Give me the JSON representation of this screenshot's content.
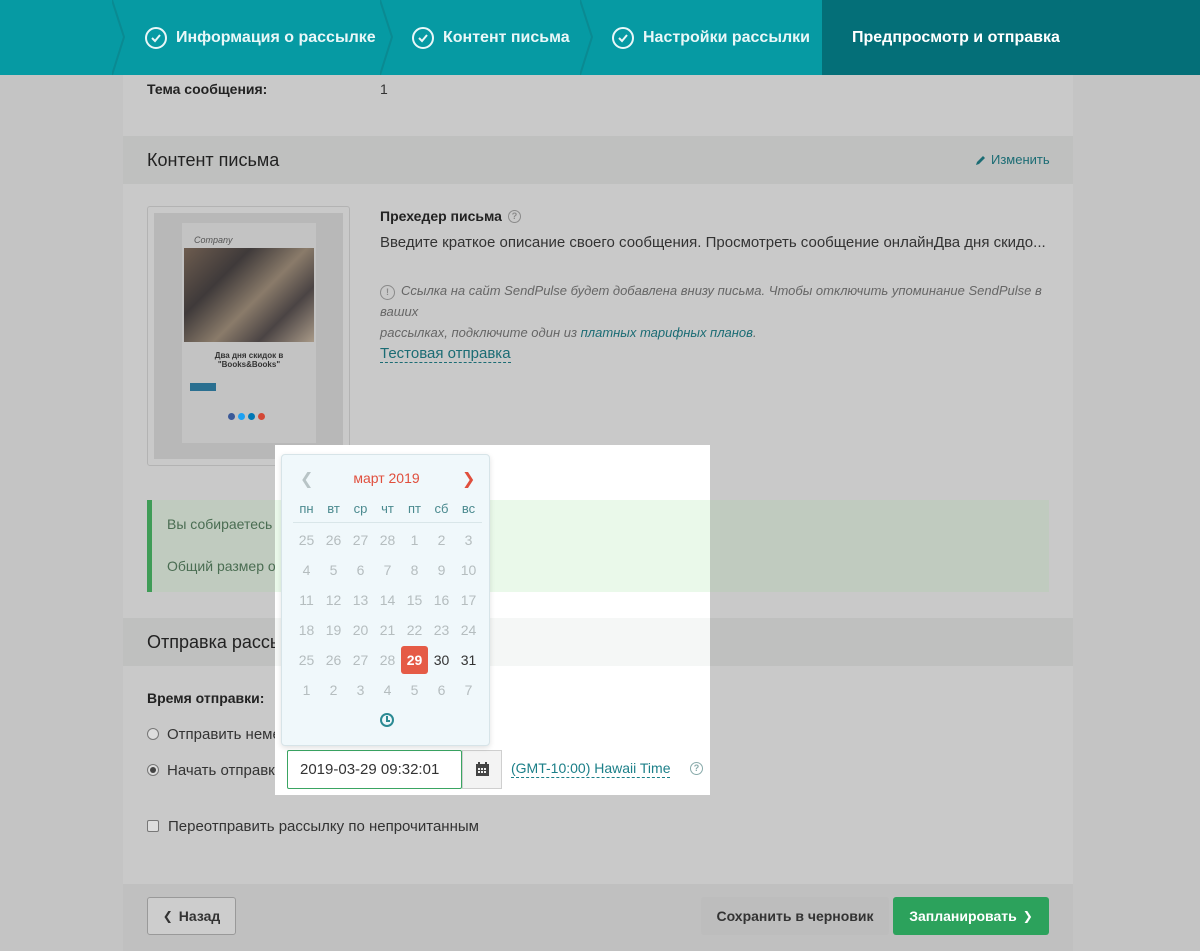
{
  "wizard": {
    "steps": [
      {
        "label": "Информация о рассылке",
        "done": true
      },
      {
        "label": "Контент письма",
        "done": true
      },
      {
        "label": "Настройки рассылки",
        "done": true
      },
      {
        "label": "Предпросмотр и отправка",
        "done": false,
        "active": true
      }
    ]
  },
  "summary": {
    "subject_label": "Тема сообщения:",
    "subject_value": "1"
  },
  "content_section": {
    "title": "Контент письма",
    "edit_label": "Изменить",
    "preheader_label": "Прехедер письма",
    "preheader_text": "Введите краткое описание своего сообщения. Просмотреть сообщение онлайнДва дня скидо...",
    "sendpulse_note_line1": "Ссылка на сайт SendPulse будет добавлена внизу письма. Чтобы отключить упоминание SendPulse в ваших",
    "sendpulse_note_line2_prefix": "рассылках, подключите один из ",
    "sendpulse_note_link": "платных тарифных планов",
    "sendpulse_note_suffix": ".",
    "test_send": "Тестовая отправка",
    "preview": {
      "logo": "Company",
      "headline_1": "Два дня скидок в",
      "headline_2": "\"Books&Books\""
    }
  },
  "notice": {
    "line1": "Вы собираетесь о",
    "line2": "Общий размер о"
  },
  "send_section": {
    "title": "Отправка рассы",
    "time_label": "Время отправки:",
    "option_now": "Отправить немед",
    "option_schedule": "Начать отправку",
    "date_value": "2019-03-29 09:32:01",
    "timezone": "(GMT-10:00) Hawaii Time",
    "resend_label": "Переотправить рассылку по непрочитанным"
  },
  "calendar": {
    "title": "март 2019",
    "weekdays": [
      "пн",
      "вт",
      "ср",
      "чт",
      "пт",
      "сб",
      "вс"
    ],
    "weeks": [
      [
        "25",
        "26",
        "27",
        "28",
        "1",
        "2",
        "3"
      ],
      [
        "4",
        "5",
        "6",
        "7",
        "8",
        "9",
        "10"
      ],
      [
        "11",
        "12",
        "13",
        "14",
        "15",
        "16",
        "17"
      ],
      [
        "18",
        "19",
        "20",
        "21",
        "22",
        "23",
        "24"
      ],
      [
        "25",
        "26",
        "27",
        "28",
        "29",
        "30",
        "31"
      ],
      [
        "1",
        "2",
        "3",
        "4",
        "5",
        "6",
        "7"
      ]
    ],
    "selected": "29"
  },
  "footer": {
    "back": "Назад",
    "save_draft": "Сохранить в черновик",
    "schedule": "Запланировать"
  },
  "colors": {
    "wizard_bg": "#069aa3",
    "wizard_active": "#046f78",
    "accent_red": "#e55b46",
    "primary_green": "#2ca25c",
    "link_teal": "#1b7f88"
  }
}
